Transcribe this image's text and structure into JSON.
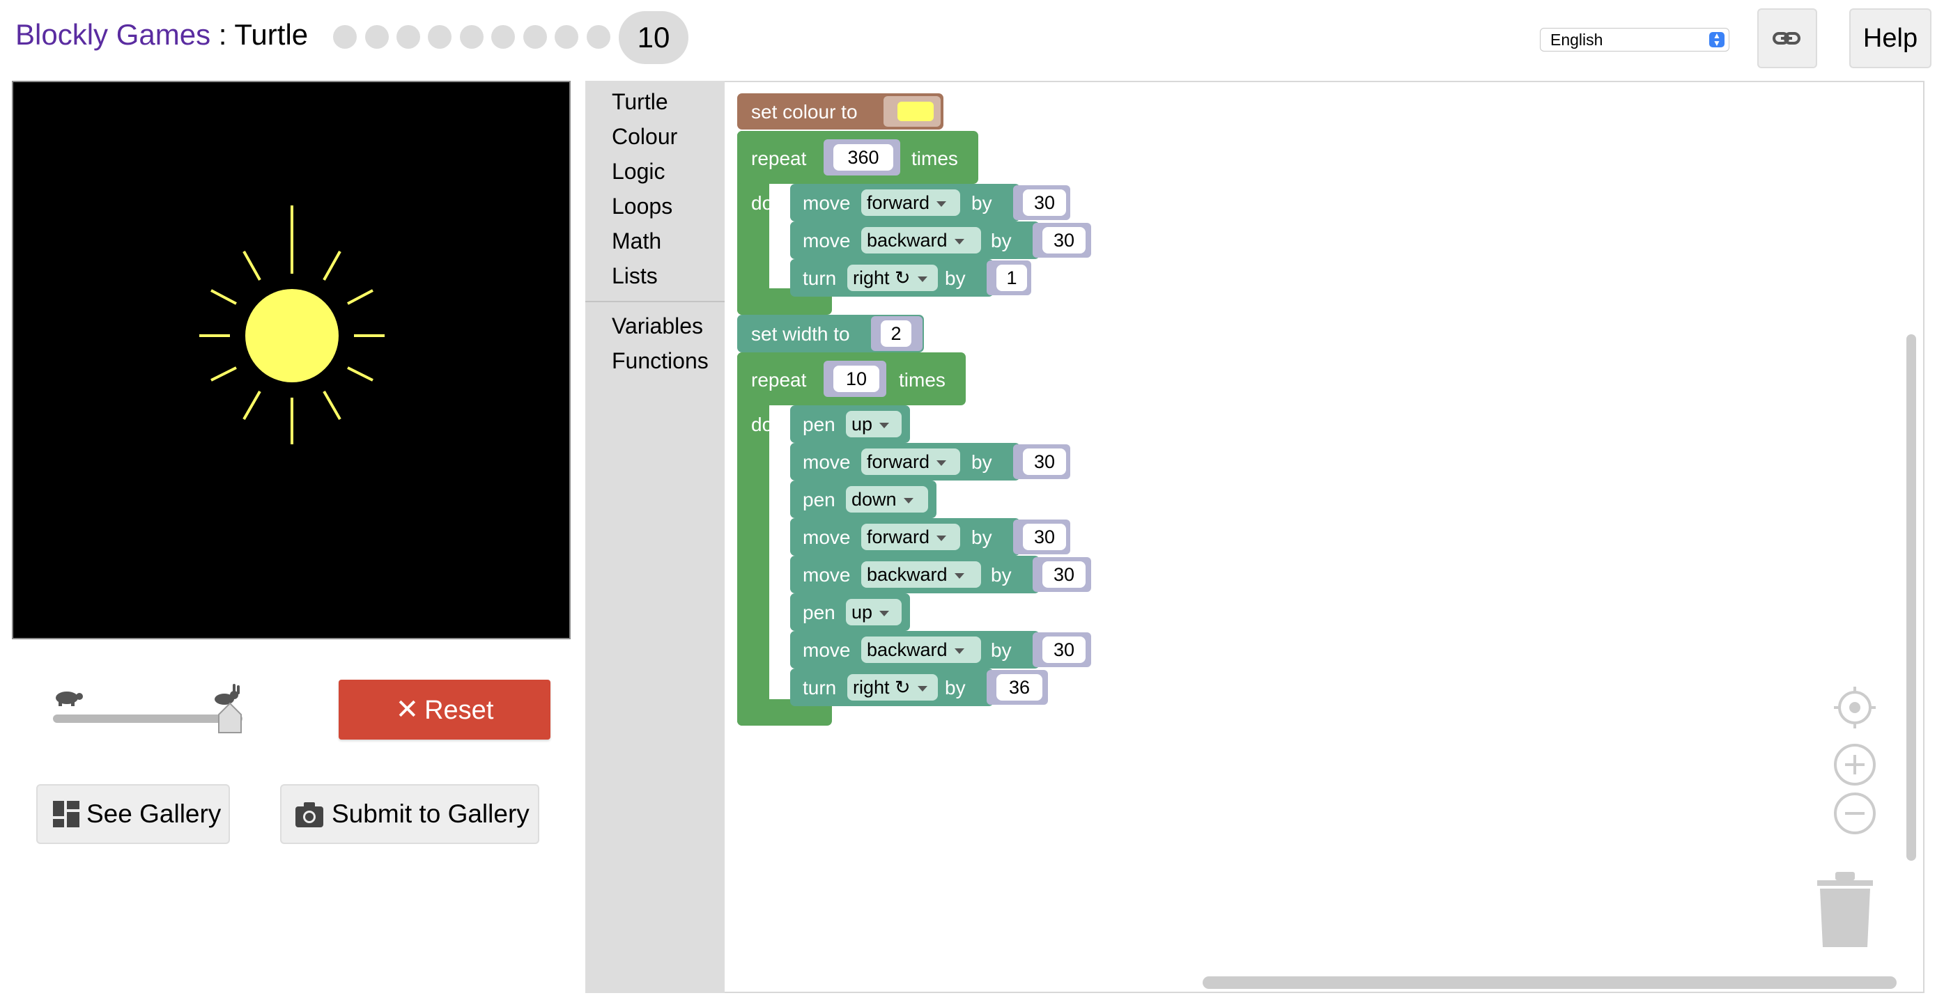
{
  "header": {
    "app_name": "Blockly Games",
    "separator": " : ",
    "page_name": "Turtle",
    "current_level": "10",
    "language": "English",
    "help_label": "Help"
  },
  "controls": {
    "reset_label": "Reset",
    "see_gallery_label": "See Gallery",
    "submit_gallery_label": "Submit to Gallery",
    "speed_slider_level": 1.0
  },
  "toolbox": {
    "categories": [
      "Turtle",
      "Colour",
      "Logic",
      "Loops",
      "Math",
      "Lists",
      "Variables",
      "Functions"
    ]
  },
  "program": {
    "set_colour_label": "set colour to",
    "colour_value": "#ffff66",
    "repeat_label": "repeat",
    "times_label": "times",
    "do_label": "do",
    "by_label": "by",
    "move_label": "move",
    "turn_label": "turn",
    "pen_label": "pen",
    "set_width_label": "set width to",
    "repeat1_count": "360",
    "loop1": [
      {
        "dir": "forward",
        "value": "30"
      },
      {
        "dir": "backward",
        "value": "30"
      },
      {
        "dir": "right ↻",
        "value": "1"
      }
    ],
    "width_value": "2",
    "repeat2_count": "10",
    "loop2": [
      {
        "dir": "up"
      },
      {
        "dir": "forward",
        "value": "30"
      },
      {
        "dir": "down"
      },
      {
        "dir": "forward",
        "value": "30"
      },
      {
        "dir": "backward",
        "value": "30"
      },
      {
        "dir": "up"
      },
      {
        "dir": "backward",
        "value": "30"
      },
      {
        "dir": "right ↻",
        "value": "36"
      }
    ]
  },
  "colors": {
    "title_purple": "#5a2ca0",
    "reset_red": "#d14836",
    "sun_yellow": "#ffff66",
    "colour_block": "#a5745b",
    "loop_block": "#5ba55b",
    "turtle_block": "#5ba58c",
    "math_block": "#b4b4d2"
  },
  "icons": [
    "link-icon",
    "turtle-icon",
    "rabbit-icon",
    "close-icon",
    "gallery-icon",
    "camera-icon",
    "recenter-icon",
    "zoom-in-icon",
    "zoom-out-icon",
    "trash-icon"
  ]
}
